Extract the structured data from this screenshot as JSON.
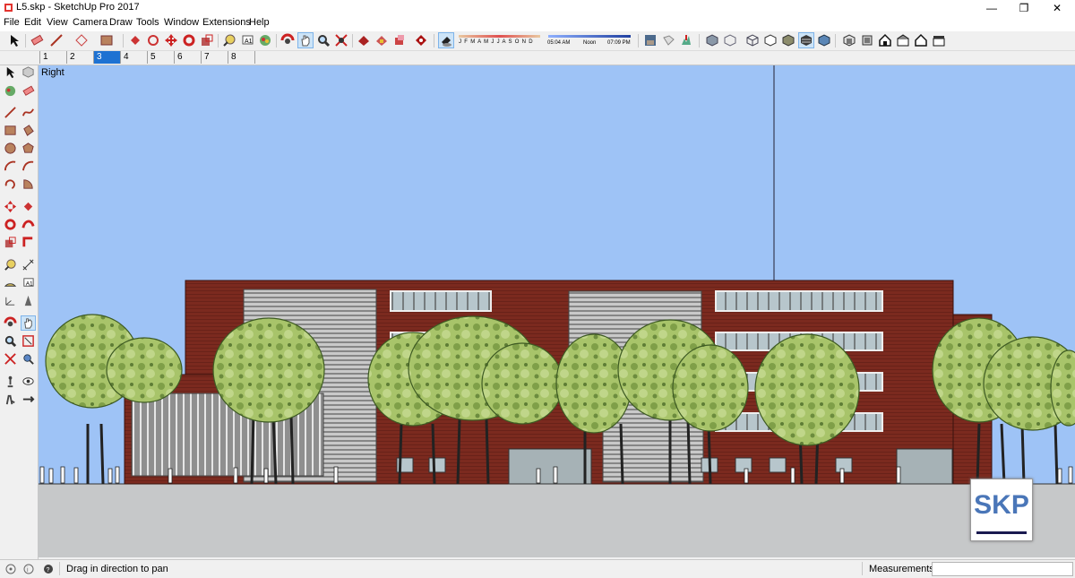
{
  "window": {
    "title": "L5.skp - SketchUp Pro 2017",
    "minimize": "—",
    "restore": "❐",
    "close": "✕"
  },
  "menu": [
    "File",
    "Edit",
    "View",
    "Camera",
    "Draw",
    "Tools",
    "Window",
    "Extensions",
    "Help"
  ],
  "shadows": {
    "months": "J F M A M J J A S O N D",
    "time_start": "05:04 AM",
    "time_mid": "Noon",
    "time_end": "07:09 PM"
  },
  "scenes": [
    "1",
    "2",
    "3",
    "4",
    "5",
    "6",
    "7",
    "8"
  ],
  "active_scene": "3",
  "viewport": {
    "view_label": "Right",
    "sky_color": "#9ec3f6",
    "ground_color": "#c6c8c9"
  },
  "badge": {
    "text": "SKP"
  },
  "status": {
    "hint": "Drag in direction to pan",
    "measurements_label": "Measurements",
    "measurements_value": ""
  },
  "colors": {
    "accent": "#1e72d2",
    "brick": "#7b2a1f",
    "tree": "#9cbc5e"
  }
}
